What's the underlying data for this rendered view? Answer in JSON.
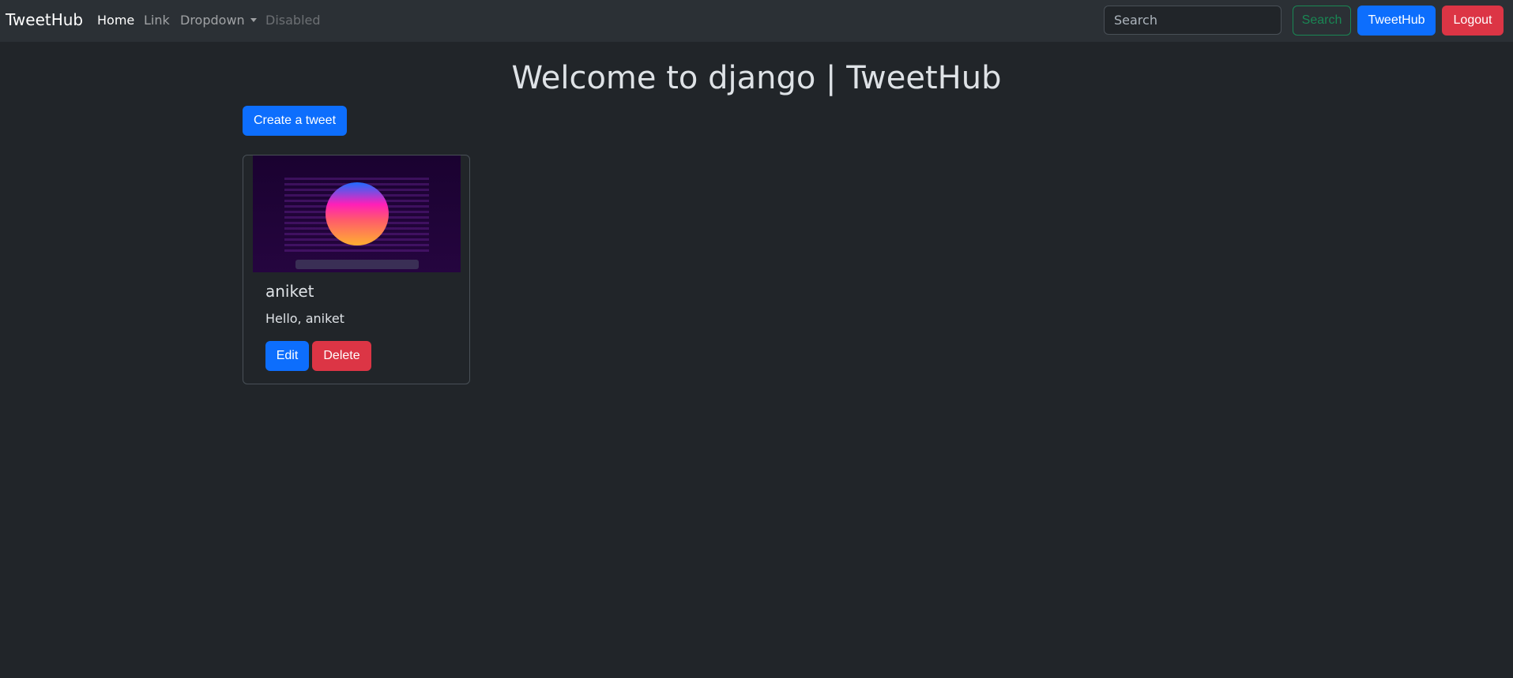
{
  "navbar": {
    "brand": "TweetHub",
    "links": [
      {
        "label": "Home"
      },
      {
        "label": "Link"
      },
      {
        "label": "Dropdown"
      },
      {
        "label": "Disabled"
      }
    ],
    "search_placeholder": "Search",
    "search_button": "Search",
    "tweethub_button": "TweetHub",
    "logout_button": "Logout"
  },
  "main": {
    "heading": "Welcome to django | TweetHub",
    "create_button": "Create a tweet",
    "tweets": [
      {
        "author": "aniket",
        "text": "Hello, aniket",
        "edit_label": "Edit",
        "delete_label": "Delete"
      }
    ]
  }
}
